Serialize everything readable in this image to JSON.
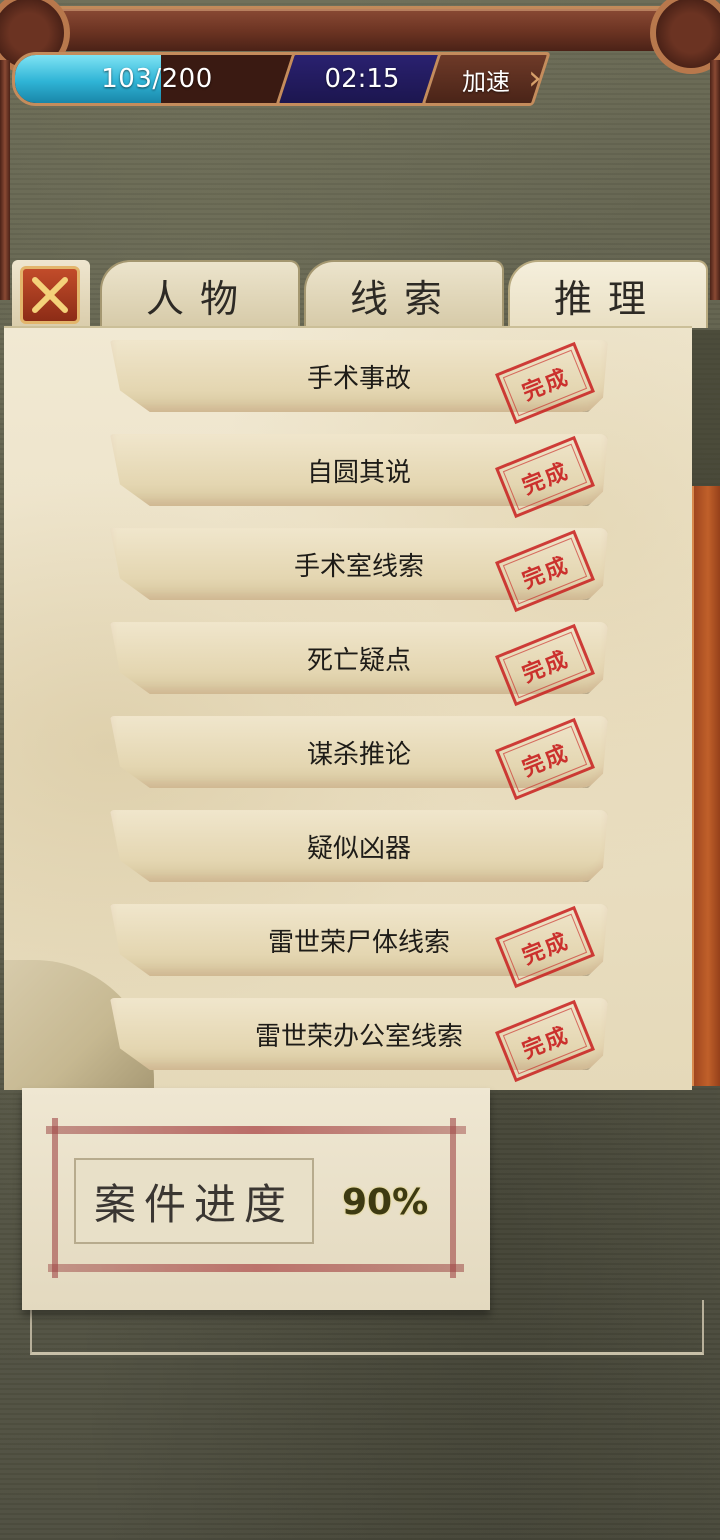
{
  "status_bar": {
    "energy_current": "103",
    "energy_max": "/200",
    "energy_fraction": 0.515,
    "timer": "02:15",
    "speed_label": "加速"
  },
  "tabs": {
    "close_icon": "close-icon",
    "items": [
      {
        "label": "人物",
        "active": false
      },
      {
        "label": "线索",
        "active": false
      },
      {
        "label": "推理",
        "active": true
      }
    ]
  },
  "deductions": [
    {
      "label": "手术事故",
      "stamp": "完成"
    },
    {
      "label": "自圆其说",
      "stamp": "完成"
    },
    {
      "label": "手术室线索",
      "stamp": "完成"
    },
    {
      "label": "死亡疑点",
      "stamp": "完成"
    },
    {
      "label": "谋杀推论",
      "stamp": "完成"
    },
    {
      "label": "疑似凶器",
      "stamp": ""
    },
    {
      "label": "雷世荣尸体线索",
      "stamp": "完成"
    },
    {
      "label": "雷世荣办公室线索",
      "stamp": "完成"
    }
  ],
  "progress": {
    "label": "案件进度",
    "value": "90%"
  },
  "colors": {
    "energy_bar": "#2fb4d6",
    "timer_bg": "#1c164f",
    "stamp_red": "#c81e1e",
    "scrollbar": "#c0602a",
    "progress_value": "#3d3a12"
  }
}
